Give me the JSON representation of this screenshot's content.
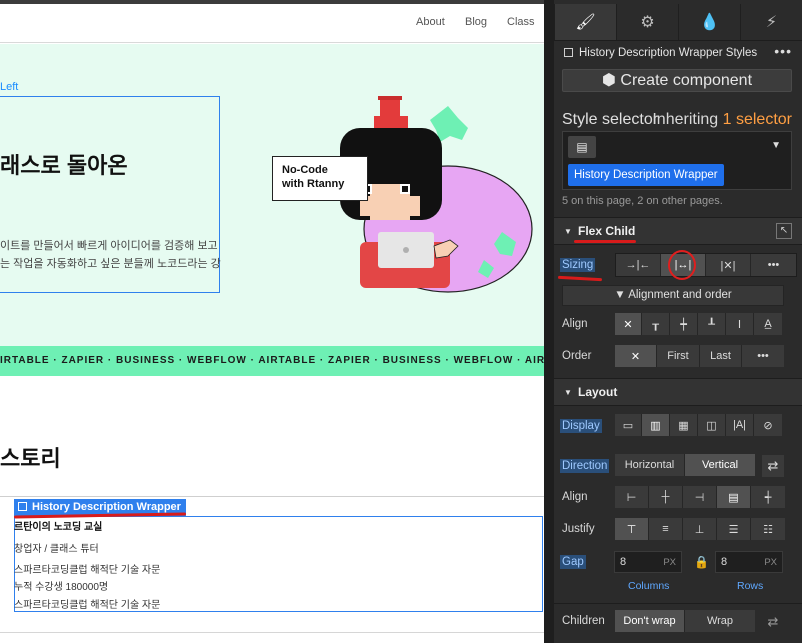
{
  "canvas": {
    "nav": {
      "links": [
        "About",
        "Blog",
        "Class"
      ]
    },
    "hero": {
      "tag": "Left",
      "title": "래스로 돌아온",
      "desc_line1": "이트를 만들어서 빠르게 아이디어를 검증해 보고",
      "desc_line2": "는 작업을 자동화하고 싶은 분들께 노코드라는 강",
      "bubble_line1": "No-Code",
      "bubble_line2": "with Rtanny"
    },
    "marquee": "IRTABLE · ZAPIER · BUSINESS · WEBFLOW · AIRTABLE · ZAPIER · BUSINESS · WEBFLOW · AIRTABLE ·",
    "history": {
      "title": "스토리",
      "wrapper_label": "History Description Wrapper",
      "lines": [
        "르탄이의 노코딩 교실",
        "창업자 / 클래스 튜터",
        "스파르타코딩클럽 해적단 기술 자문",
        "누적 수강생 180000명",
        "스파르타코딩클럽 해적단 기술 자문"
      ]
    }
  },
  "panel": {
    "tabs": [
      {
        "icon": "paintbrush-icon",
        "glyph": "🖌"
      },
      {
        "icon": "gear-icon",
        "glyph": "⚙"
      },
      {
        "icon": "drops-icon",
        "glyph": "💧"
      },
      {
        "icon": "lightning-icon",
        "glyph": "⚡"
      }
    ],
    "selected_element": "History Description Wrapper Styles",
    "create_component": "Create component",
    "style_selector_label": "Style selector",
    "inheriting_prefix": "Inheriting",
    "inheriting_count": "1 selector",
    "selector_chip": "History Description Wrapper",
    "on_page": "5 on this page, 2 on other pages.",
    "flex_child": {
      "title": "Flex Child",
      "sizing_label": "Sizing",
      "alignment_and_order": "Alignment and order",
      "align_label": "Align",
      "order_label": "Order",
      "order_first": "First",
      "order_last": "Last"
    },
    "layout": {
      "title": "Layout",
      "display_label": "Display",
      "direction_label": "Direction",
      "direction_horizontal": "Horizontal",
      "direction_vertical": "Vertical",
      "align_label": "Align",
      "justify_label": "Justify",
      "gap_label": "Gap",
      "gap_columns": "8",
      "gap_rows": "8",
      "gap_unit": "PX",
      "columns_label": "Columns",
      "rows_label": "Rows",
      "children_label": "Children",
      "children_dont_wrap": "Don't wrap",
      "children_wrap": "Wrap"
    },
    "colors": {
      "accent_blue": "#1f6feb",
      "inherit_orange": "#ff9f43",
      "annotation_red": "#d81b1b"
    }
  }
}
